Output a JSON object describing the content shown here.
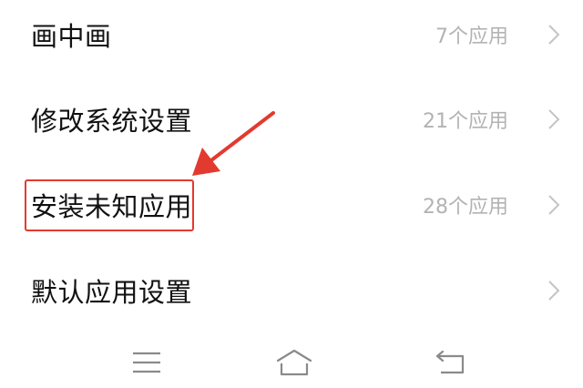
{
  "settings_list": {
    "items": [
      {
        "title": "画中画",
        "value": "7个应用"
      },
      {
        "title": "修改系统设置",
        "value": "21个应用"
      },
      {
        "title": "安装未知应用",
        "value": "28个应用"
      },
      {
        "title": "默认应用设置",
        "value": ""
      }
    ]
  },
  "annotation": {
    "highlighted_item": "安装未知应用",
    "color": "#e33a2f"
  },
  "nav_bar": {
    "buttons": [
      "menu-icon",
      "home-icon",
      "back-icon"
    ]
  },
  "colors": {
    "title_text": "#111111",
    "value_text": "#b3b3b3",
    "chevron": "#c4c4c4",
    "nav_icon": "#8a8a8a"
  }
}
